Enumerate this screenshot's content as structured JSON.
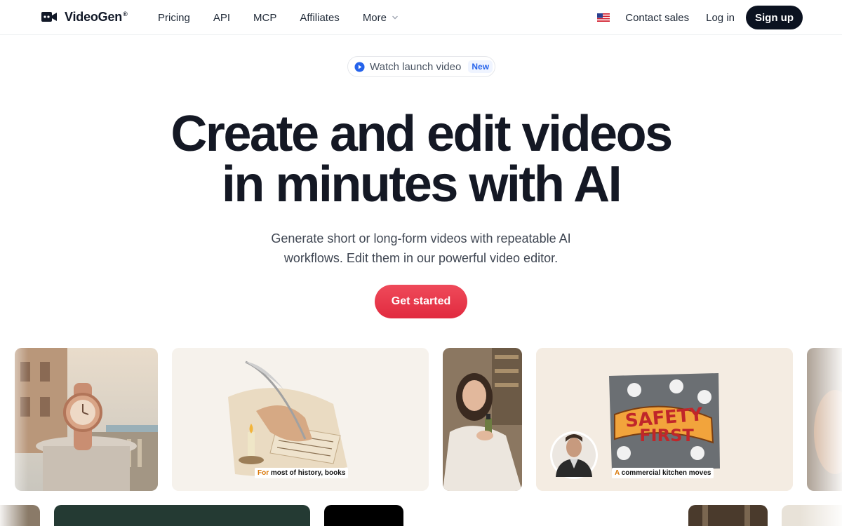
{
  "brand": {
    "name": "VideoGen",
    "mark": "®"
  },
  "nav": {
    "links": [
      "Pricing",
      "API",
      "MCP",
      "Affiliates",
      "More"
    ],
    "contact": "Contact sales",
    "login": "Log in",
    "signup": "Sign up"
  },
  "hero": {
    "pill_text": "Watch launch video",
    "pill_badge": "New",
    "title_line1": "Create and edit videos",
    "title_line2": "in minutes with AI",
    "subtitle_line1": "Generate short or long-form videos with repeatable AI",
    "subtitle_line2": "workflows. Edit them in our powerful video editor.",
    "cta": "Get started"
  },
  "gallery": {
    "card2_caption_hl": "For",
    "card2_caption_rest": " most of history, books",
    "card4_sign_line1": "SAFETY",
    "card4_sign_line2": "FIRST",
    "card4_caption_hl": "A",
    "card4_caption_rest": " commercial kitchen moves"
  },
  "colors": {
    "accent": "#e8334a",
    "dark": "#0b1220",
    "badge": "#2563eb"
  }
}
